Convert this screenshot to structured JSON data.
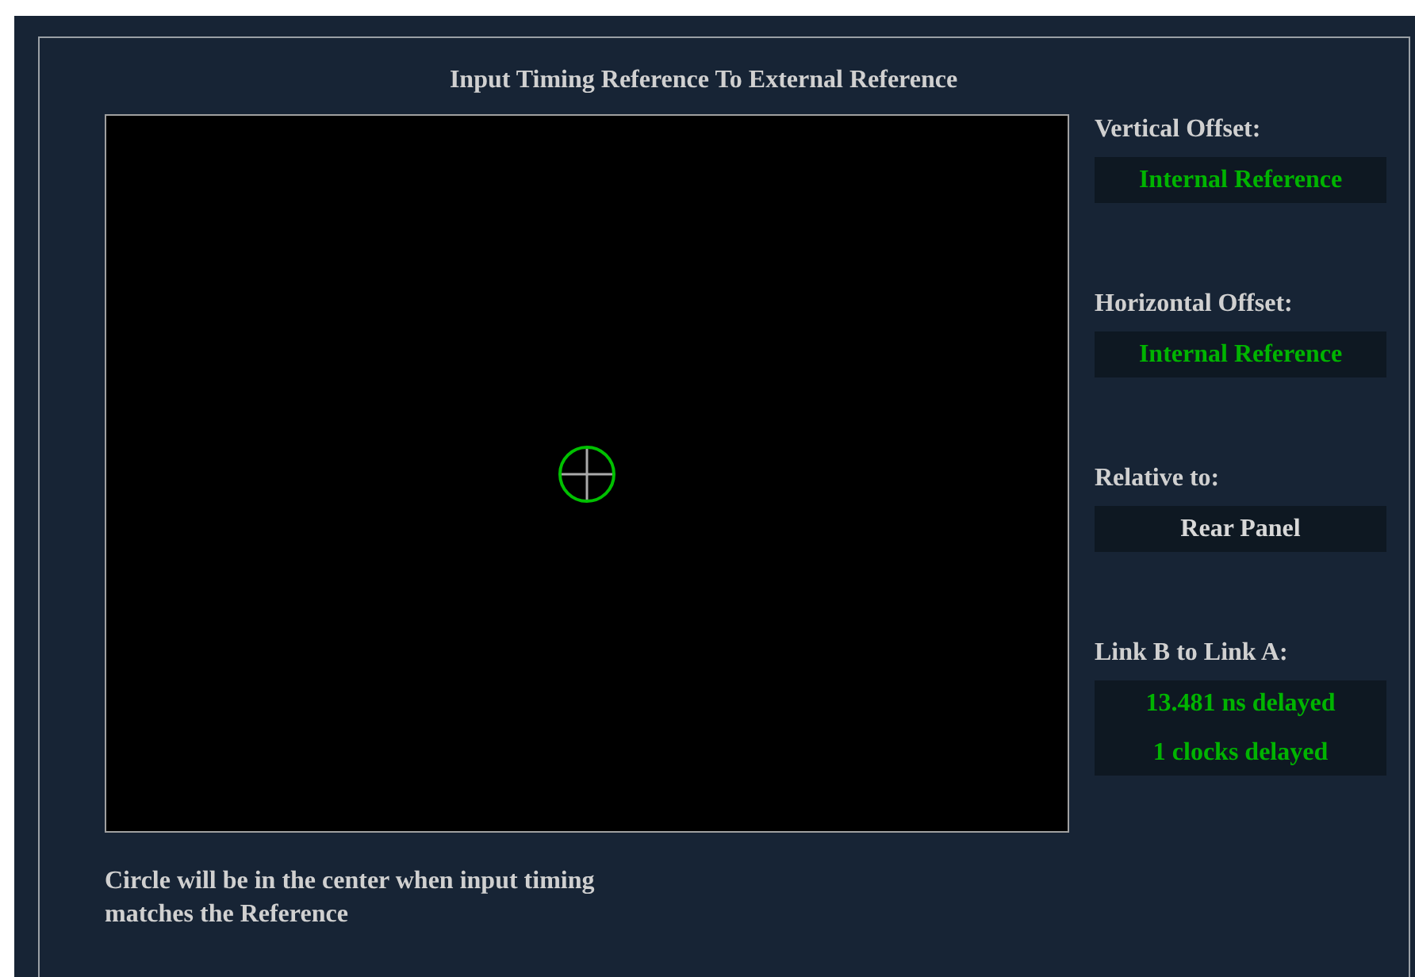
{
  "title": "Input Timing Reference To External Reference",
  "fields": [
    {
      "label": "Vertical Offset:",
      "values": [
        "Internal Reference"
      ],
      "color": "#00b400"
    },
    {
      "label": "Horizontal Offset:",
      "values": [
        "Internal Reference"
      ],
      "color": "#00b400"
    },
    {
      "label": "Relative to:",
      "values": [
        "Rear Panel"
      ],
      "color": "#d8d8d8"
    },
    {
      "label": "Link B to Link A:",
      "values": [
        "13.481 ns delayed",
        "1 clocks delayed"
      ],
      "color": "#00b400"
    }
  ],
  "caption": "Circle will be in the center when input timing matches the Reference"
}
